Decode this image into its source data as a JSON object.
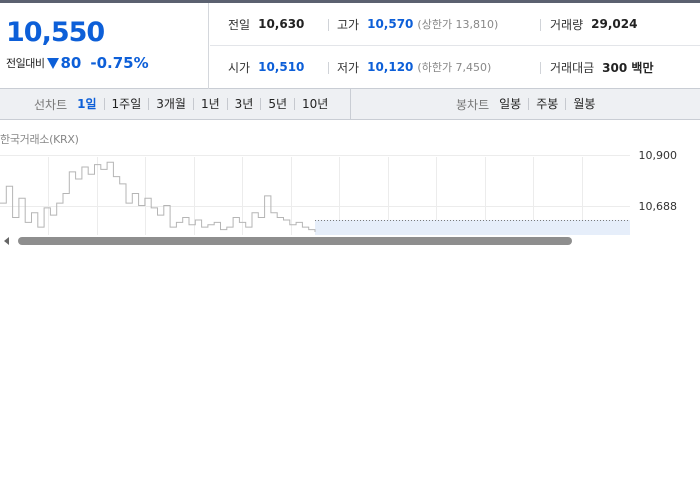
{
  "summary": {
    "current_price": "10,550",
    "change_label": "전일대비",
    "change_value": "80",
    "change_rate": "-0.75%",
    "prev_close_label": "전일",
    "prev_close": "10,630",
    "high_label": "고가",
    "high": "10,570",
    "upper_limit": "(상한가 13,810)",
    "volume_label": "거래량",
    "volume": "29,024",
    "open_label": "시가",
    "open": "10,510",
    "low_label": "저가",
    "low": "10,120",
    "lower_limit": "(하한가 7,450)",
    "value_label": "거래대금",
    "value": "300 백만"
  },
  "line_chart_tabs": {
    "label": "선차트",
    "items": [
      "1일",
      "1주일",
      "3개월",
      "1년",
      "3년",
      "5년",
      "10년"
    ],
    "active": "1일"
  },
  "candle_chart_tabs": {
    "label": "봉차트",
    "items": [
      "일봉",
      "주봉",
      "월봉"
    ]
  },
  "chart": {
    "market_label": "한국거래소(KRX)"
  },
  "colors": {
    "down": "#0d5fd8",
    "line": "#b5b5b5",
    "volume_fill": "#e6eefa"
  },
  "chart_data": {
    "type": "line",
    "title": "",
    "xlabel": "",
    "ylabel": "",
    "y_ticks": [
      "10,900",
      "10,688"
    ],
    "y_tick_values": [
      10900,
      10688
    ],
    "ylim": [
      10460,
      10950
    ],
    "reference_line": 10630,
    "grid": true,
    "x_range": [
      0,
      100
    ],
    "x": [
      0,
      1,
      2,
      3,
      4,
      5,
      6,
      7,
      8,
      9,
      10,
      11,
      12,
      13,
      14,
      15,
      16,
      17,
      18,
      19,
      20,
      21,
      22,
      23,
      24,
      25,
      26,
      27,
      28,
      29,
      30,
      31,
      32,
      33,
      34,
      35,
      36,
      37,
      38,
      39,
      40,
      41,
      42,
      43,
      44,
      45,
      46,
      47,
      48,
      49,
      50
    ],
    "values": [
      10700,
      10770,
      10640,
      10720,
      10620,
      10660,
      10600,
      10680,
      10650,
      10700,
      10740,
      10830,
      10800,
      10850,
      10820,
      10860,
      10840,
      10870,
      10810,
      10780,
      10700,
      10740,
      10690,
      10720,
      10680,
      10650,
      10690,
      10600,
      10620,
      10640,
      10610,
      10630,
      10600,
      10610,
      10620,
      10590,
      10600,
      10640,
      10620,
      10600,
      10660,
      10640,
      10730,
      10660,
      10640,
      10630,
      10610,
      10620,
      10600,
      10590,
      10580
    ]
  }
}
